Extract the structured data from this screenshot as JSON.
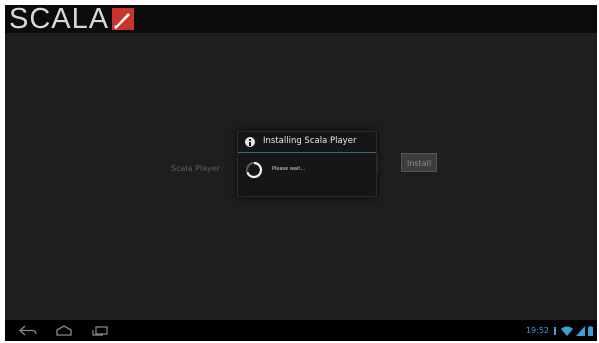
{
  "brand": {
    "logo_text": "SCALA",
    "logo_color": "#c9342c"
  },
  "main": {
    "player_label": "Scala Player",
    "install_label": "Install"
  },
  "dialog": {
    "title": "Installing Scala Player",
    "message": "Please wait..."
  },
  "navbar": {
    "icons": [
      "back-icon",
      "home-icon",
      "recent-apps-icon"
    ]
  },
  "status": {
    "time": "19:52",
    "icons": [
      "notification-icon",
      "wifi-icon",
      "signal-icon",
      "battery-icon"
    ],
    "accent": "#38a3d3"
  }
}
